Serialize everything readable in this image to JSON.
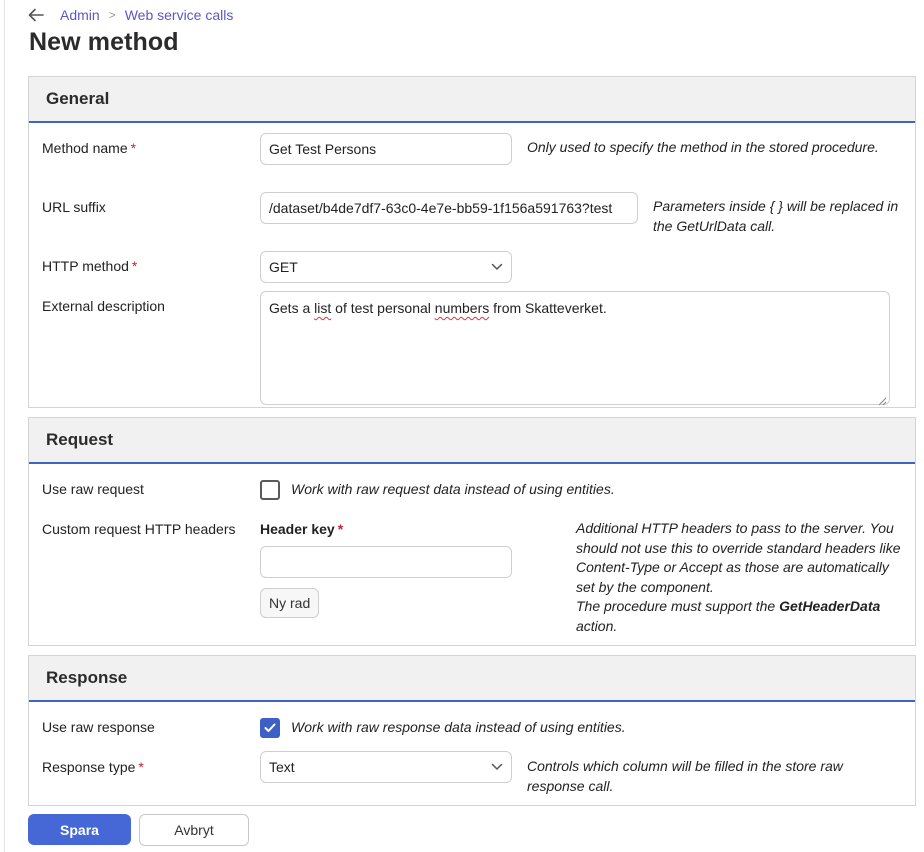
{
  "breadcrumb": {
    "items": [
      "Admin",
      "Web service calls"
    ],
    "separator": ">"
  },
  "page": {
    "title": "New method"
  },
  "general": {
    "header": "General",
    "method_name": {
      "label": "Method name",
      "required_mark": "*",
      "value": "Get Test Persons",
      "hint": "Only used to specify the method in the stored procedure."
    },
    "url_suffix": {
      "label": "URL suffix",
      "value": "/dataset/b4de7df7-63c0-4e7e-bb59-1f156a591763?test",
      "hint": "Parameters inside { } will be replaced in the GetUrlData call."
    },
    "http_method": {
      "label": "HTTP method",
      "required_mark": "*",
      "selected": "GET"
    },
    "external_description": {
      "label": "External description",
      "text_before": "Gets a ",
      "text_mis1": "list",
      "text_mid": " of test personal ",
      "text_mis2": "numbers",
      "text_after": " from Skatteverket."
    }
  },
  "request": {
    "header": "Request",
    "use_raw": {
      "label": "Use raw request",
      "checked": false,
      "hint": "Work with raw request data instead of using entities."
    },
    "custom_headers": {
      "label": "Custom request HTTP headers",
      "header_key_label": "Header key",
      "required_mark": "*",
      "header_key_value": "",
      "add_row_label": "Ny rad",
      "hint_line1": "Additional HTTP headers to pass to the server. You should not use this to override standard headers like Content-Type or Accept as those are automatically set by the component.",
      "hint_line2_before": "The procedure must support the ",
      "hint_line2_bold": "GetHeaderData",
      "hint_line2_after": " action."
    }
  },
  "response": {
    "header": "Response",
    "use_raw": {
      "label": "Use raw response",
      "checked": true,
      "hint": "Work with raw response data instead of using entities."
    },
    "response_type": {
      "label": "Response type",
      "required_mark": "*",
      "selected": "Text",
      "hint": "Controls which column will be filled in the store raw response call."
    }
  },
  "actions": {
    "save_label": "Spara",
    "cancel_label": "Avbryt"
  },
  "colors": {
    "accent": "#4668d6",
    "link": "#5b57c8",
    "required": "#c4213b",
    "section_rule": "#4064c4"
  },
  "icons": {
    "back": "arrow-left-icon",
    "select": "chevron-down-icon",
    "check": "checkmark-icon"
  }
}
